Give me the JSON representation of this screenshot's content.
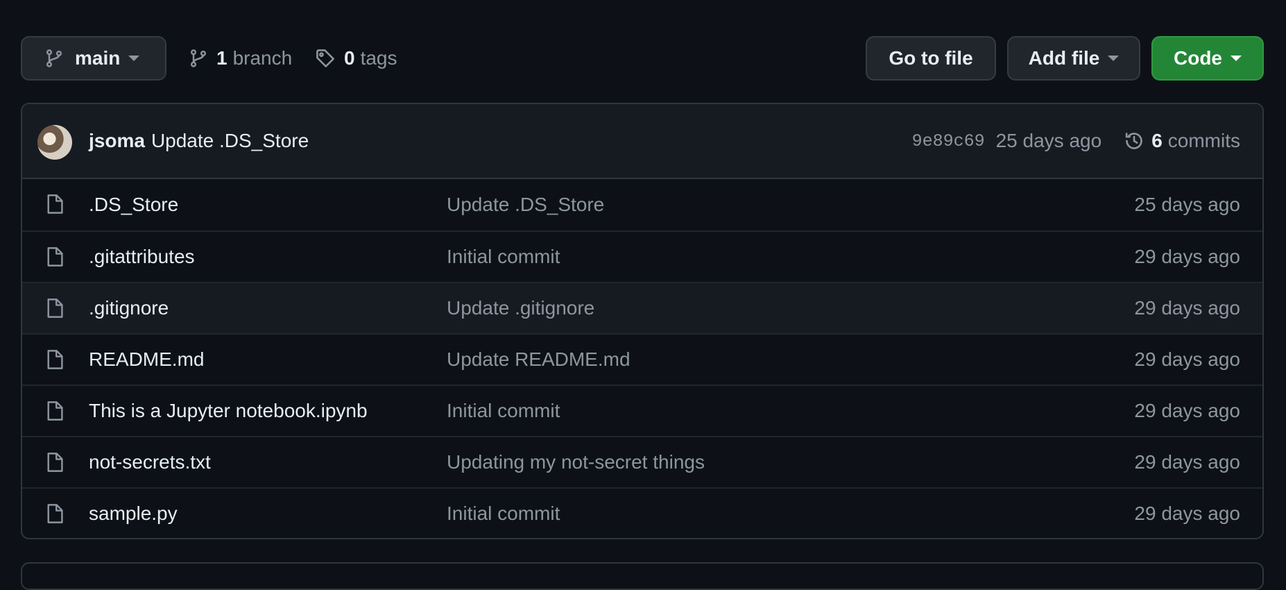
{
  "toolbar": {
    "branch_selector": {
      "label": "main",
      "icon": "git-branch-icon"
    },
    "branches": {
      "count": "1",
      "label": "branch",
      "icon": "git-branch-icon"
    },
    "tags": {
      "count": "0",
      "label": "tags",
      "icon": "tag-icon"
    },
    "go_to_file_label": "Go to file",
    "add_file_label": "Add file",
    "code_label": "Code",
    "code_button_color": "#238636"
  },
  "latest_commit": {
    "author": "jsoma",
    "message": "Update .DS_Store",
    "sha": "9e89c69",
    "age": "25 days ago",
    "commits_count": "6",
    "commits_label": "commits"
  },
  "files": [
    {
      "name": ".DS_Store",
      "message": "Update .DS_Store",
      "age": "25 days ago"
    },
    {
      "name": ".gitattributes",
      "message": "Initial commit",
      "age": "29 days ago"
    },
    {
      "name": ".gitignore",
      "message": "Update .gitignore",
      "age": "29 days ago"
    },
    {
      "name": "README.md",
      "message": "Update README.md",
      "age": "29 days ago"
    },
    {
      "name": "This is a Jupyter notebook.ipynb",
      "message": "Initial commit",
      "age": "29 days ago"
    },
    {
      "name": "not-secrets.txt",
      "message": "Updating my not-secret things",
      "age": "29 days ago"
    },
    {
      "name": "sample.py",
      "message": "Initial commit",
      "age": "29 days ago"
    }
  ],
  "colors": {
    "background": "#0d1117",
    "border": "#30363d",
    "muted_text": "#8d96a0",
    "primary_text": "#e6edf3"
  }
}
